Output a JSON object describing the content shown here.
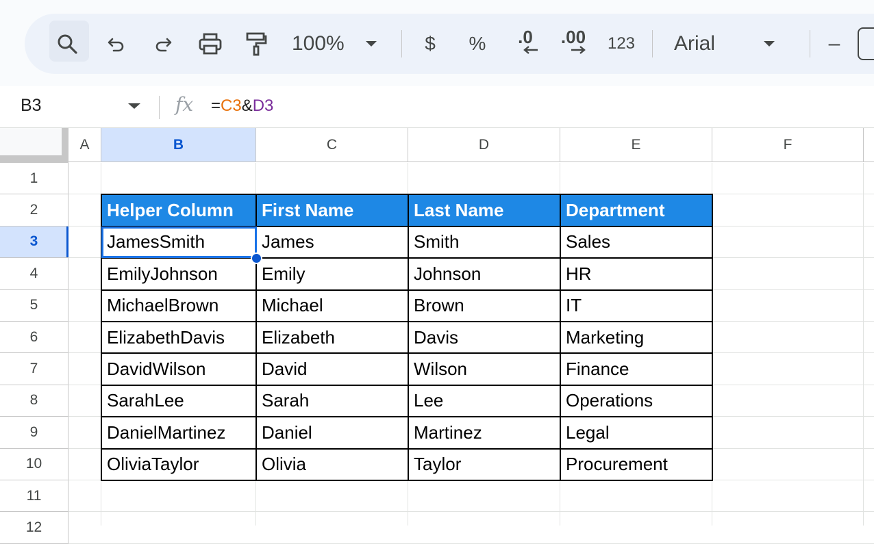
{
  "toolbar": {
    "zoom": "100%",
    "currency": "$",
    "percent": "%",
    "decrease_decimal": ".0",
    "increase_decimal": ".00",
    "number_format": "123",
    "font": "Arial",
    "minus": "–"
  },
  "formula_bar": {
    "name_box": "B3",
    "fx": "fx",
    "formula_prefix": "=",
    "formula_ref1": "C3",
    "formula_op": "&",
    "formula_ref2": "D3"
  },
  "columns": [
    "A",
    "B",
    "C",
    "D",
    "E",
    "F"
  ],
  "rows": [
    "1",
    "2",
    "3",
    "4",
    "5",
    "6",
    "7",
    "8",
    "9",
    "10",
    "11",
    "12"
  ],
  "table": {
    "headers": [
      "Helper Column",
      "First Name",
      "Last Name",
      "Department"
    ],
    "rows": [
      [
        "JamesSmith",
        "James",
        "Smith",
        "Sales"
      ],
      [
        "EmilyJohnson",
        "Emily",
        "Johnson",
        "HR"
      ],
      [
        "MichaelBrown",
        "Michael",
        "Brown",
        "IT"
      ],
      [
        "ElizabethDavis",
        "Elizabeth",
        "Davis",
        "Marketing"
      ],
      [
        "DavidWilson",
        "David",
        "Wilson",
        "Finance"
      ],
      [
        "SarahLee",
        "Sarah",
        "Lee",
        "Operations"
      ],
      [
        "DanielMartinez",
        "Daniel",
        "Martinez",
        "Legal"
      ],
      [
        "OliviaTaylor",
        "Olivia",
        "Taylor",
        "Procurement"
      ]
    ]
  },
  "colors": {
    "header_fill": "#1e88e5",
    "selection": "#1a73e8",
    "selected_header": "#d3e3fd"
  }
}
